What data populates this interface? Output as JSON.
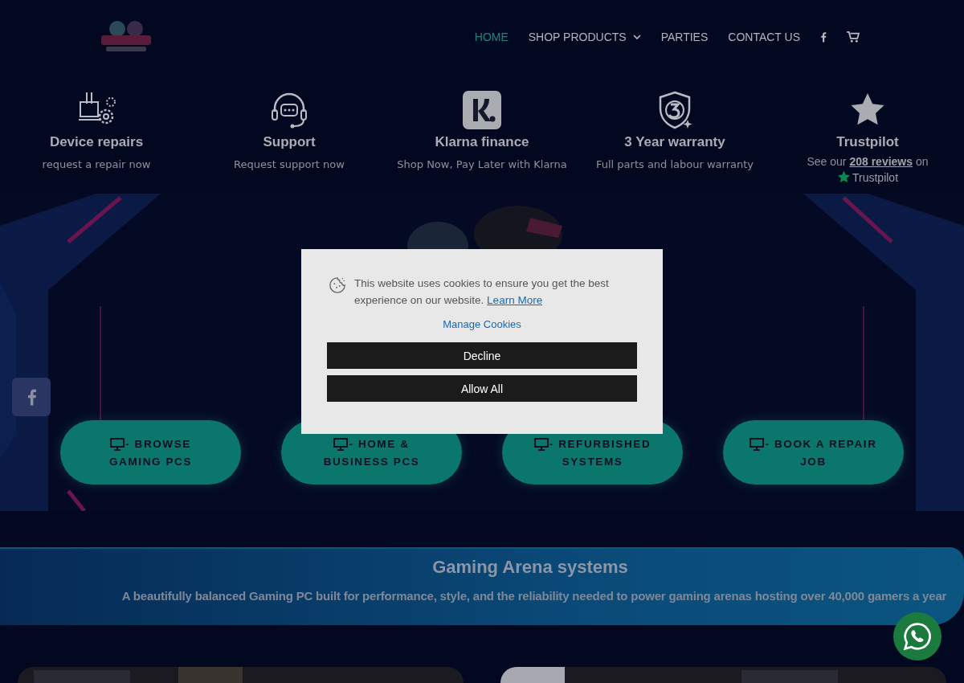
{
  "header": {
    "nav": [
      {
        "label": "HOME",
        "selected": true,
        "has_menu": false
      },
      {
        "label": "SHOP PRODUCTS",
        "selected": false,
        "has_menu": true
      },
      {
        "label": "PARTIES",
        "selected": false,
        "has_menu": false
      },
      {
        "label": "CONTACT US",
        "selected": false,
        "has_menu": false
      }
    ]
  },
  "features": [
    {
      "kind": "repair",
      "title": "Device repairs",
      "subtitle": "request a repair now"
    },
    {
      "kind": "support",
      "title": "Support",
      "subtitle": "Request support now"
    },
    {
      "kind": "klarna",
      "title": "Klarna finance",
      "subtitle": "Shop Now, Pay Later with Klarna"
    },
    {
      "kind": "warranty",
      "title": "3 Year warranty",
      "subtitle": "Full parts and labour warranty"
    },
    {
      "kind": "trustpilot",
      "title": "Trustpilot",
      "review_prefix": "See our",
      "review_link": "208 reviews",
      "review_suffix": "on",
      "brand": "Trustpilot"
    }
  ],
  "hero": {
    "kind": "picture",
    "buttons": [
      {
        "line1": "- BROWSE",
        "line2": "GAMING PCS"
      },
      {
        "line1": "- HOME &",
        "line2": "BUSINESS PCS"
      },
      {
        "line1": "- REFURBISHED",
        "line2": "SYSTEMS"
      },
      {
        "line1": "- BOOK A REPAIR",
        "line2": "JOB"
      }
    ]
  },
  "banner": {
    "title": "Gaming Arena systems",
    "text": "A beautifully balanced Gaming PC built for performance, style, and the reliability needed to power gaming arenas hosting over 40,000 gamers a year"
  },
  "cookie_dialog": {
    "message": "This website uses cookies to ensure you get the best experience on our website.",
    "learn_more": "Learn More",
    "manage": "Manage Cookies",
    "buttons": [
      "Decline",
      "Allow All"
    ]
  }
}
